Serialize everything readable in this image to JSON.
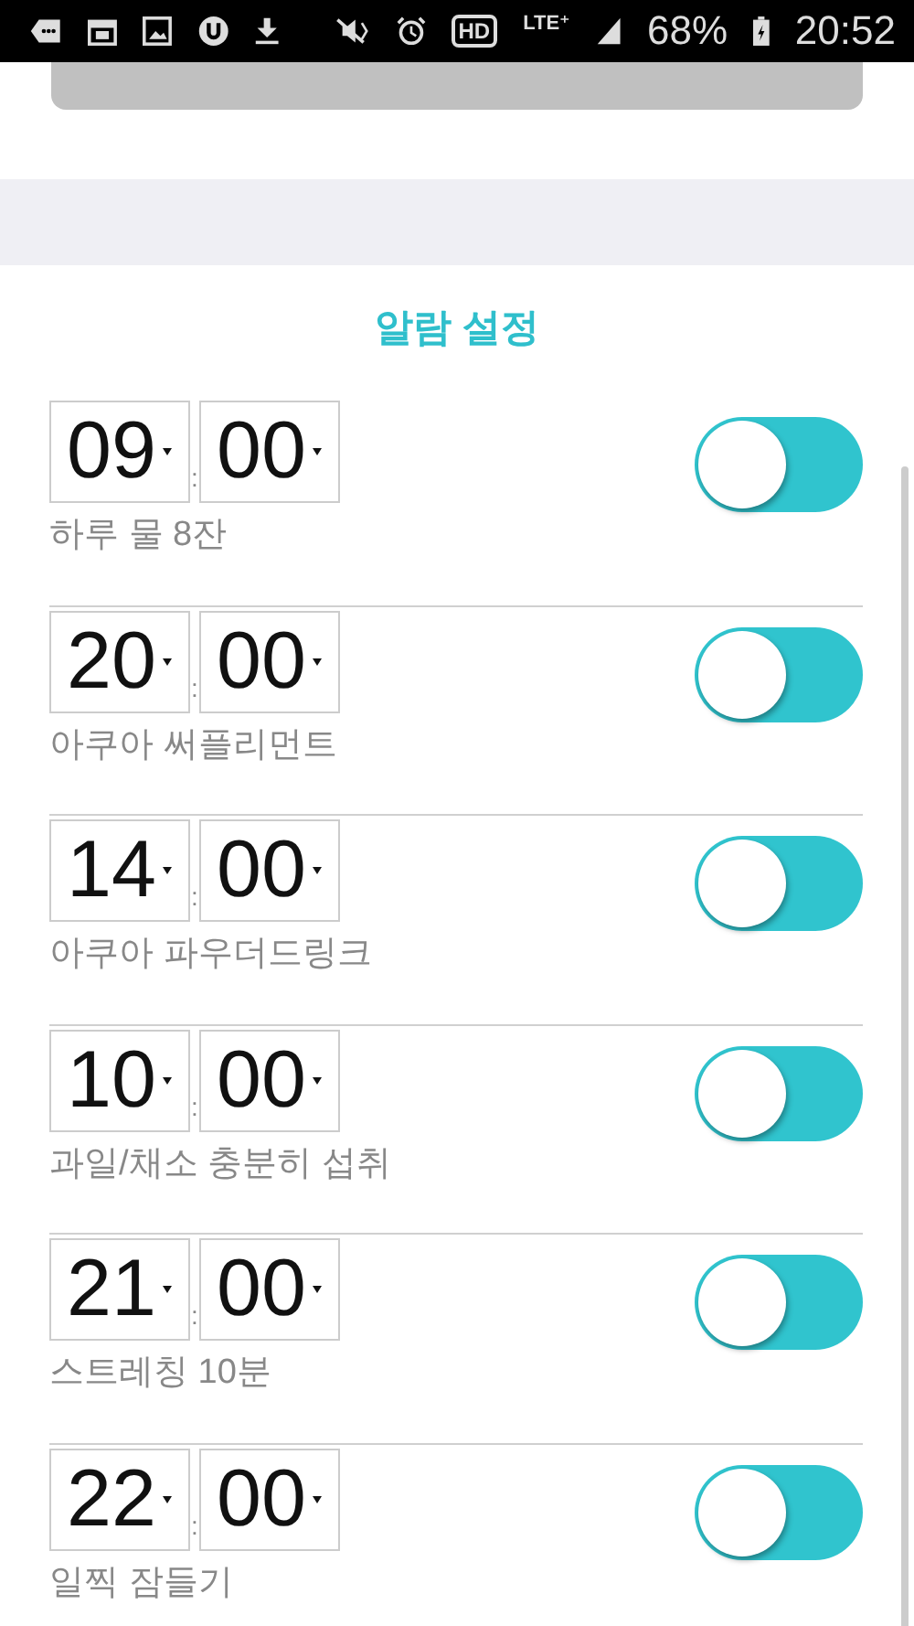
{
  "status_bar": {
    "network_badge": "HD",
    "network_type": "LTE⁺",
    "battery": "68%",
    "time": "20:52"
  },
  "section_title": "알람 설정",
  "alarms": [
    {
      "hour": "09",
      "minute": "00",
      "separator": ":",
      "label": "하루 물 8잔",
      "on": true
    },
    {
      "hour": "20",
      "minute": "00",
      "separator": ":",
      "label": "아쿠아 써플리먼트",
      "on": true
    },
    {
      "hour": "14",
      "minute": "00",
      "separator": ":",
      "label": "아쿠아 파우더드링크",
      "on": true
    },
    {
      "hour": "10",
      "minute": "00",
      "separator": ":",
      "label": "과일/채소 충분히 섭취",
      "on": true
    },
    {
      "hour": "21",
      "minute": "00",
      "separator": ":",
      "label": "스트레칭 10분",
      "on": true
    },
    {
      "hour": "22",
      "minute": "00",
      "separator": ":",
      "label": "일찍 잠들기",
      "on": true
    }
  ]
}
